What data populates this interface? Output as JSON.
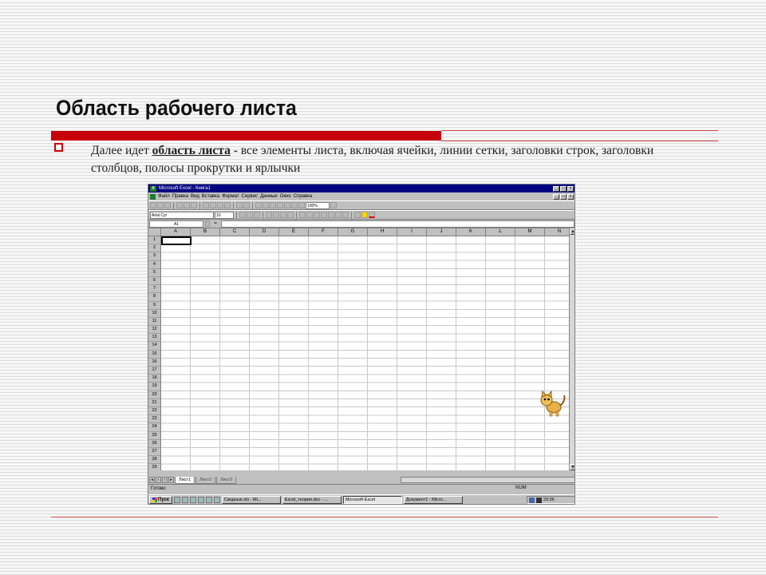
{
  "slide": {
    "title": "Область рабочего листа",
    "text_prefix": "Далее идет ",
    "text_bold": "область листа",
    "text_rest": " - все элементы листа, включая ячейки, линии сетки, заголовки строк, заголовки столбцов, полосы прокрутки и ярлычки"
  },
  "excel": {
    "title": "Microsoft Excel - Книга1",
    "app_icon_label": "X",
    "menu": [
      "Файл",
      "Правка",
      "Вид",
      "Вставка",
      "Формат",
      "Сервис",
      "Данные",
      "Окно",
      "Справка"
    ],
    "zoom": "100%",
    "font_name": "Arial Cyr",
    "font_size": "10",
    "name_box": "A1",
    "formula_eq": "=",
    "columns": [
      "A",
      "B",
      "C",
      "D",
      "E",
      "F",
      "G",
      "H",
      "I",
      "J",
      "K",
      "L",
      "M",
      "N"
    ],
    "rows": [
      "1",
      "2",
      "3",
      "4",
      "5",
      "6",
      "7",
      "8",
      "9",
      "10",
      "11",
      "12",
      "13",
      "14",
      "15",
      "16",
      "17",
      "18",
      "19",
      "20",
      "21",
      "22",
      "23",
      "24",
      "25",
      "26",
      "27",
      "28",
      "29"
    ],
    "sheet_tabs": [
      "Лист1",
      "Лист2",
      "Лист3"
    ],
    "status": "Готово",
    "status_num": "NUM"
  },
  "taskbar": {
    "start": "Пуск",
    "tasks": [
      "Сводные.xls - Mi...",
      "Excel_теория.doc - ...",
      "Microsoft Excel",
      "Документ1 - Micro..."
    ],
    "clock": "23:36"
  },
  "icons": {
    "bullet": "hollow-square-bullet",
    "mascot": "office-cat-assistant"
  },
  "colors": {
    "accent_red": "#c8000c",
    "title_bar": "#000080"
  }
}
